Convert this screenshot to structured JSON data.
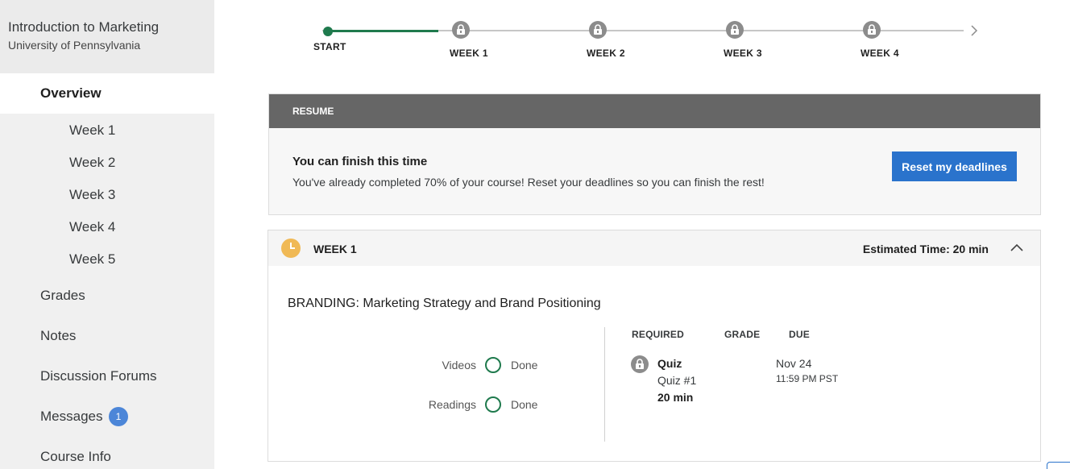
{
  "course": {
    "title": "Introduction to Marketing",
    "university": "University of Pennsylvania"
  },
  "sidebar": {
    "overview": "Overview",
    "weeks": [
      "Week 1",
      "Week 2",
      "Week 3",
      "Week 4",
      "Week 5"
    ],
    "grades": "Grades",
    "notes": "Notes",
    "forums": "Discussion Forums",
    "messages": "Messages",
    "messages_badge": "1",
    "course_info": "Course Info"
  },
  "progress": {
    "start_label": "START",
    "week_labels": [
      "WEEK 1",
      "WEEK 2",
      "WEEK 3",
      "WEEK 4"
    ],
    "completed_color": "#1f7a4d",
    "locked_icon": "lock-icon",
    "next_icon": "chevron-right-icon"
  },
  "resume": {
    "header": "RESUME",
    "title": "You can finish this time",
    "message": "You've already completed 70% of your course! Reset your deadlines so you can finish the rest!",
    "button": "Reset my deadlines",
    "button_color": "#2a73cc"
  },
  "week": {
    "title": "WEEK 1",
    "estimated": "Estimated Time: 20 min",
    "clock_icon": "clock-icon",
    "clock_color": "#f0b955",
    "collapse_icon": "chevron-up-icon",
    "lesson": "BRANDING: Marketing Strategy and Brand Positioning",
    "activities": [
      {
        "label": "Videos",
        "status": "Done"
      },
      {
        "label": "Readings",
        "status": "Done"
      }
    ],
    "columns": {
      "required": "REQUIRED",
      "grade": "GRADE",
      "due": "DUE"
    },
    "assignment": {
      "type": "Quiz",
      "name": "Quiz #1",
      "duration": "20 min",
      "due_date": "Nov 24",
      "due_time": "11:59 PM PST"
    }
  }
}
